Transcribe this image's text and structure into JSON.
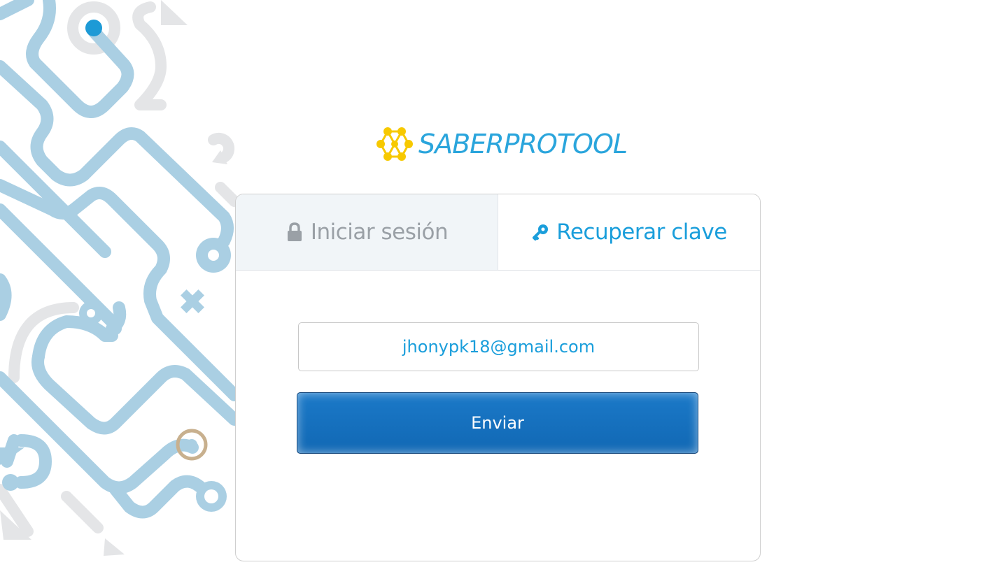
{
  "brand": {
    "name": "SABERPROTOOL",
    "color": "#2aa5dc",
    "logo_color": "#f7c900"
  },
  "tabs": [
    {
      "label": "Iniciar sesión",
      "icon": "lock-icon",
      "active": false
    },
    {
      "label": "Recuperar clave",
      "icon": "key-icon",
      "active": true
    }
  ],
  "form": {
    "email_value": "jhonypk18@gmail.com",
    "submit_label": "Enviar"
  },
  "colors": {
    "accent": "#1a9edb",
    "button": "#1168b4",
    "inactive_tab_bg": "#f1f5f8",
    "inactive_tab_text": "#9aa0a6",
    "art_blue": "#aacfe3",
    "art_gray": "#e4e5e7"
  }
}
